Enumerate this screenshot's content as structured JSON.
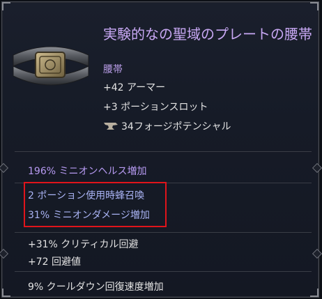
{
  "item": {
    "name": "実験的なの聖域のプレートの腰帯",
    "type": "腰帯",
    "icon": "plate-belt-icon"
  },
  "implicits": {
    "armor": "+42 アーマー",
    "potion_slots": "+3 ポーションスロット"
  },
  "forge": {
    "icon": "anvil-icon",
    "text": "34フォージポテンシャル"
  },
  "affixes": {
    "minion_health": "196% ミニオンヘルス増加",
    "bee_summon": "2 ポーション使用時蜂召喚",
    "minion_damage": "31% ミニオンダメージ増加",
    "crit_avoid": "+31% クリティカル回避",
    "dodge": "+72 回避値",
    "cooldown": "9% クールダウン回復速度増加"
  },
  "colors": {
    "title": "#c8a8f4",
    "affix_blue": "#a9b3f4",
    "affix_purple": "#b79af2",
    "highlight": "#e0141b"
  }
}
